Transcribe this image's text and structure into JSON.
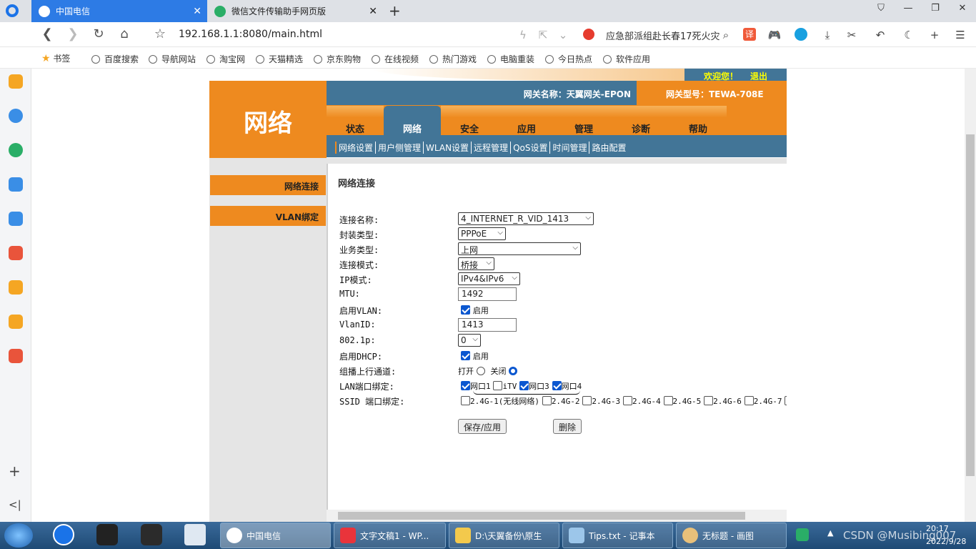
{
  "browser": {
    "tabs": [
      {
        "label": "中国电信",
        "active": true
      },
      {
        "label": "微信文件传输助手网页版",
        "active": false
      }
    ],
    "new_tab": "+",
    "url": "192.168.1.1:8080/main.html",
    "search_query": "应急部派组赴长春17死火灾",
    "bookmarks": [
      "书签",
      "百度搜索",
      "导航网站",
      "淘宝网",
      "天猫精选",
      "京东购物",
      "在线视频",
      "热门游戏",
      "电脑重装",
      "今日热点",
      "软件应用"
    ],
    "sidebar_add": "+",
    "sidebar_collapse": "<|"
  },
  "router": {
    "welcome": "欢迎您！",
    "logout": "退出",
    "logo": "网络",
    "gateway_name": "网关名称：天翼网关-EPON",
    "gateway_model": "网关型号：TEWA-708E",
    "menu": [
      "状态",
      "网络",
      "安全",
      "应用",
      "管理",
      "诊断",
      "帮助"
    ],
    "active_menu": "网络",
    "submenu": [
      "网络设置",
      "用户侧管理",
      "WLAN设置",
      "远程管理",
      "QoS设置",
      "时间管理",
      "路由配置"
    ],
    "left_menu": [
      "网络连接",
      "VLAN绑定"
    ],
    "section_title": "网络连接",
    "form": {
      "conn_name_label": "连接名称:",
      "conn_name_value": "4_INTERNET_R_VID_1413",
      "encap_label": "封装类型:",
      "encap_value": "PPPoE",
      "service_label": "业务类型:",
      "service_value": "上网",
      "mode_label": "连接模式:",
      "mode_value": "桥接",
      "ip_mode_label": "IP模式:",
      "ip_mode_value": "IPv4&IPv6",
      "mtu_label": "MTU:",
      "mtu_value": "1492",
      "vlan_enable_label": "启用VLAN:",
      "vlan_enable_text": "启用",
      "vlanid_label": "VlanID:",
      "vlanid_value": "1413",
      "p8021_label": "802.1p:",
      "p8021_value": "0",
      "dhcp_label": "启用DHCP:",
      "dhcp_text": "启用",
      "multicast_label": "组播上行通道:",
      "multicast_on": "打开",
      "multicast_off": "关闭",
      "lan_label": "LAN端口绑定:",
      "lan_ports": [
        {
          "label": "网口1",
          "checked": true
        },
        {
          "label": "iTV",
          "checked": false
        },
        {
          "label": "网口3",
          "checked": true
        },
        {
          "label": "网口4",
          "checked": true
        }
      ],
      "ssid_label": "SSID 端口绑定:",
      "ssid_ports": [
        "2.4G-1(无线网络)",
        "2.4G-2",
        "2.4G-3",
        "2.4G-4",
        "2.4G-5",
        "2.4G-6",
        "2.4G-7"
      ],
      "save_btn": "保存/应用",
      "delete_btn": "删除"
    }
  },
  "taskbar": {
    "items": [
      "中国电信",
      "文字文稿1 - WP...",
      "D:\\天翼备份\\原生",
      "Tips.txt - 记事本",
      "无标题 - 画图"
    ],
    "time": "20:17",
    "date": "2022/9/28",
    "watermark": "CSDN @Musibing007"
  }
}
